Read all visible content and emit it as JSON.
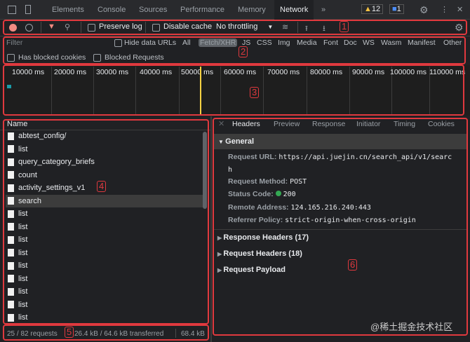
{
  "tabs": [
    "Elements",
    "Console",
    "Sources",
    "Performance",
    "Memory",
    "Network"
  ],
  "active_tab": "Network",
  "more": "»",
  "warnings": "12",
  "messages": "1",
  "toolbar": {
    "preserve_log": "Preserve log",
    "disable_cache": "Disable cache",
    "throttling": "No throttling"
  },
  "filter": {
    "placeholder": "Filter",
    "hide_data_urls": "Hide data URLs",
    "types": [
      "All",
      "Fetch/XHR",
      "JS",
      "CSS",
      "Img",
      "Media",
      "Font",
      "Doc",
      "WS",
      "Wasm",
      "Manifest",
      "Other"
    ],
    "selected": "Fetch/XHR",
    "blocked_cookies": "Has blocked cookies",
    "blocked_requests": "Blocked Requests"
  },
  "timeline": {
    "ticks": [
      "10000 ms",
      "20000 ms",
      "30000 ms",
      "40000 ms",
      "50000 ms",
      "60000 ms",
      "70000 ms",
      "80000 ms",
      "90000 ms",
      "100000 ms",
      "110000 ms"
    ]
  },
  "list": {
    "header": "Name",
    "items": [
      "abtest_config/",
      "list",
      "query_category_briefs",
      "count",
      "activity_settings_v1",
      "search",
      "list",
      "list",
      "list",
      "list",
      "list",
      "list",
      "list",
      "list",
      "list"
    ],
    "selected": "search"
  },
  "status": {
    "requests": "25 / 82 requests",
    "transferred": "26.4 kB / 64.6 kB transferred",
    "resources": "68.4 kB"
  },
  "details": {
    "tabs": [
      "Headers",
      "Preview",
      "Response",
      "Initiator",
      "Timing",
      "Cookies"
    ],
    "general": "General",
    "fields": [
      {
        "k": "Request URL:",
        "v": "https://api.juejin.cn/search_api/v1/search"
      },
      {
        "k": "Request Method:",
        "v": "POST"
      },
      {
        "k": "Status Code:",
        "v": "200"
      },
      {
        "k": "Remote Address:",
        "v": "124.165.216.240:443"
      },
      {
        "k": "Referrer Policy:",
        "v": "strict-origin-when-cross-origin"
      }
    ],
    "url_line1": "https://api.juejin.cn/search_api/v1/searc",
    "url_line2": "h",
    "sections": [
      "Response Headers (17)",
      "Request Headers (18)",
      "Request Payload"
    ]
  },
  "annotations": [
    "1",
    "2",
    "3",
    "4",
    "5",
    "6"
  ],
  "watermark": "@稀土掘金技术社区",
  "colors": {
    "annotation": "#e0393e",
    "record": "#f28b82",
    "status_ok": "#34a853",
    "playhead": "#f5d142"
  }
}
